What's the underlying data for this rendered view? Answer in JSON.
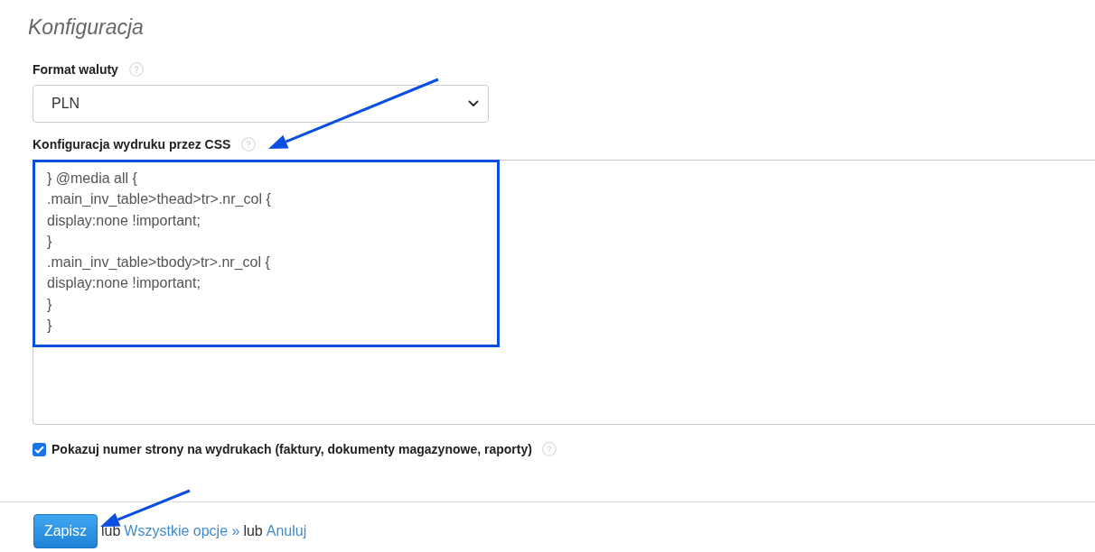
{
  "title": "Konfiguracja",
  "currency_format": {
    "label": "Format waluty",
    "value": "PLN"
  },
  "print_css": {
    "label": "Konfiguracja wydruku przez CSS",
    "value": "} @media all {\n.main_inv_table>thead>tr>.nr_col {\ndisplay:none !important;\n}\n.main_inv_table>tbody>tr>.nr_col {\ndisplay:none !important;\n}\n}"
  },
  "show_page_numbers": {
    "label": "Pokazuj numer strony na wydrukach (faktury, dokumenty magazynowe, raporty)",
    "checked": true
  },
  "footer": {
    "save_button": "Zapisz",
    "items": [
      {
        "kind": "text",
        "text": "lub"
      },
      {
        "kind": "link",
        "text": "Wszystkie opcje »"
      },
      {
        "kind": "text",
        "text": "lub"
      },
      {
        "kind": "link",
        "text": "Anuluj"
      }
    ]
  }
}
